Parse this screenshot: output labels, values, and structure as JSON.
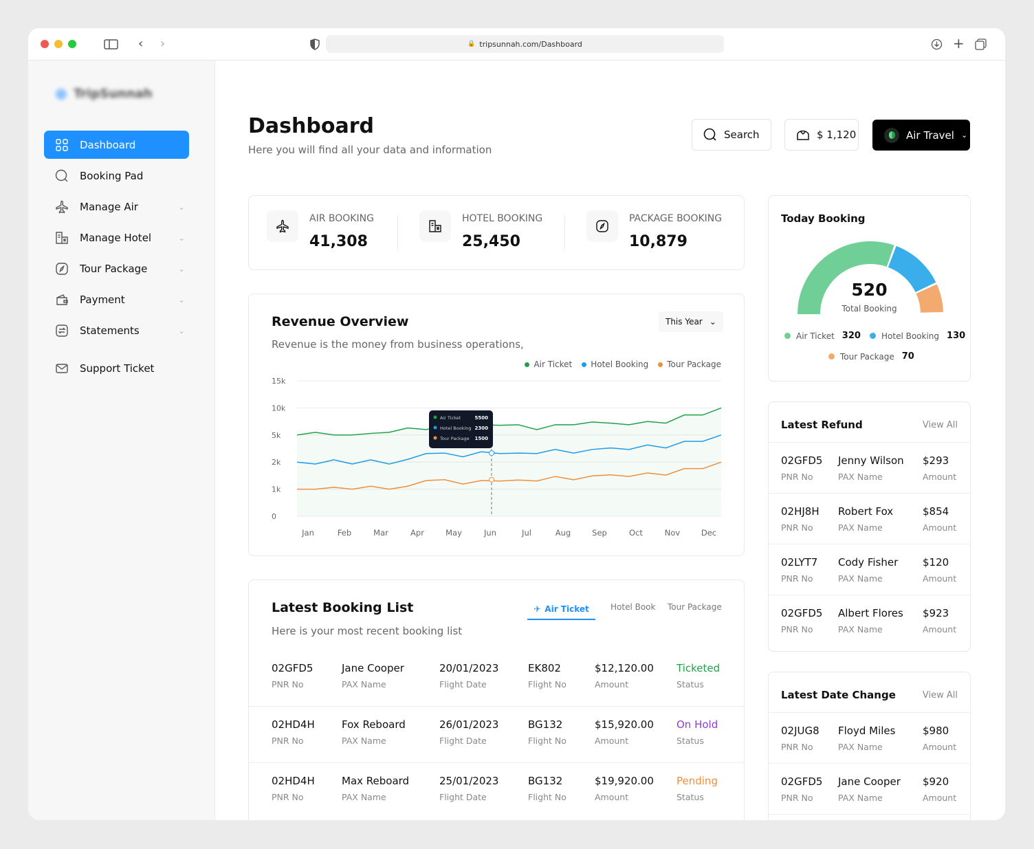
{
  "browser": {
    "url": "tripsunnah.com/Dashboard",
    "icons": [
      "sidebar-toggle-icon",
      "back-icon",
      "forward-icon",
      "shield-icon",
      "lock-icon",
      "download-icon",
      "new-tab-icon",
      "tabs-icon"
    ]
  },
  "sidebar": {
    "logo_text": "TripSunnah",
    "items": [
      {
        "label": "Dashboard",
        "icon": "grid-icon",
        "active": true
      },
      {
        "label": "Booking Pad",
        "icon": "search-icon"
      },
      {
        "label": "Manage Air",
        "icon": "plane-icon",
        "expandable": true
      },
      {
        "label": "Manage Hotel",
        "icon": "hotel-icon",
        "expandable": true
      },
      {
        "label": "Tour Package",
        "icon": "compass-icon",
        "expandable": true
      },
      {
        "label": "Payment",
        "icon": "wallet-icon",
        "expandable": true
      },
      {
        "label": "Statements",
        "icon": "statement-icon",
        "expandable": true
      },
      {
        "label": "Support Ticket",
        "icon": "mail-icon"
      }
    ]
  },
  "header": {
    "title": "Dashboard",
    "subtitle": "Here you will find all your data and information",
    "search_label": "Search",
    "balance": "$ 1,120",
    "travel_mode": "Air Travel"
  },
  "stats": [
    {
      "label": "AIR BOOKING",
      "value": "41,308",
      "icon": "plane-icon"
    },
    {
      "label": "HOTEL BOOKING",
      "value": "25,450",
      "icon": "hotel-icon"
    },
    {
      "label": "PACKAGE BOOKING",
      "value": "10,879",
      "icon": "compass-icon"
    }
  ],
  "revenue": {
    "title": "Revenue Overview",
    "subtitle": "Revenue is the money from business operations,",
    "period": "This Year"
  },
  "chart_data": {
    "type": "line",
    "categories": [
      "Jan",
      "Feb",
      "Mar",
      "Apr",
      "May",
      "Jun",
      "Jul",
      "Aug",
      "Sep",
      "Oct",
      "Nov",
      "Dec"
    ],
    "yticks": [
      "0",
      "1k",
      "2k",
      "5k",
      "10k",
      "15k"
    ],
    "ytick_values": [
      0,
      1000,
      2000,
      5000,
      10000,
      15000
    ],
    "grid": true,
    "legend": "top-right",
    "series": [
      {
        "name": "Air Ticket",
        "color": "#1fa14a",
        "values": [
          5000,
          5500,
          5000,
          5000,
          5300,
          5500,
          6300,
          6000,
          6800,
          7000,
          6900,
          6800,
          6900,
          6000,
          6900,
          6900,
          7400,
          7200,
          6900,
          7500,
          7200,
          8700,
          8700,
          10000
        ]
      },
      {
        "name": "Hotel Booking",
        "color": "#1e9be9",
        "values": [
          2000,
          1930,
          2250,
          1930,
          2250,
          1930,
          2300,
          2950,
          3000,
          2590,
          3150,
          2950,
          3000,
          2950,
          3400,
          3000,
          3400,
          3570,
          3400,
          3900,
          3570,
          4300,
          4300,
          5000
        ]
      },
      {
        "name": "Tour Package",
        "color": "#ef8f3b",
        "values": [
          1000,
          1000,
          1070,
          1000,
          1110,
          1000,
          1110,
          1320,
          1350,
          1190,
          1320,
          1300,
          1340,
          1300,
          1470,
          1350,
          1490,
          1530,
          1470,
          1600,
          1520,
          1760,
          1760,
          2000
        ]
      }
    ],
    "tooltip": {
      "category": "Jun",
      "rows": [
        {
          "name": "Air Ticket",
          "value": "5500"
        },
        {
          "name": "Hotel Booking",
          "value": "2300"
        },
        {
          "name": "Tour Package",
          "value": "1500"
        }
      ]
    }
  },
  "today": {
    "title": "Today Booking",
    "total": "520",
    "total_label": "Total Booking",
    "items": [
      {
        "name": "Air Ticket",
        "value": "320",
        "color": "#6fcf97"
      },
      {
        "name": "Hotel Booking",
        "value": "130",
        "color": "#3aaeeb"
      },
      {
        "name": "Tour Package",
        "value": "70",
        "color": "#f2aa6e"
      }
    ]
  },
  "booking_list": {
    "title": "Latest Booking List",
    "subtitle": "Here is your most recent booking list",
    "tabs": [
      "Air Ticket",
      "Hotel Book",
      "Tour Package"
    ],
    "sublabels": [
      "PNR No",
      "PAX Name",
      "Flight Date",
      "Flight No",
      "Amount",
      "Status"
    ],
    "rows": [
      {
        "pnr": "02GFD5",
        "name": "Jane Cooper",
        "date": "20/01/2023",
        "flight": "EK802",
        "amount": "$12,120.00",
        "status": "Ticketed",
        "status_color": "#1fa14a"
      },
      {
        "pnr": "02HD4H",
        "name": "Fox Reboard",
        "date": "26/01/2023",
        "flight": "BG132",
        "amount": "$15,920.00",
        "status": "On Hold",
        "status_color": "#8a3fd1"
      },
      {
        "pnr": "02HD4H",
        "name": "Max Reboard",
        "date": "25/01/2023",
        "flight": "BG132",
        "amount": "$19,920.00",
        "status": "Pending",
        "status_color": "#ef8f3b"
      }
    ]
  },
  "refund": {
    "title": "Latest Refund",
    "view_all": "View All",
    "sublabels": [
      "PNR No",
      "PAX Name",
      "Amount"
    ],
    "rows": [
      {
        "pnr": "02GFD5",
        "name": "Jenny Wilson",
        "amount": "$293"
      },
      {
        "pnr": "02HJ8H",
        "name": "Robert Fox",
        "amount": "$854"
      },
      {
        "pnr": "02LYT7",
        "name": "Cody Fisher",
        "amount": "$120"
      },
      {
        "pnr": "02GFD5",
        "name": "Albert Flores",
        "amount": "$923"
      }
    ]
  },
  "date_change": {
    "title": "Latest Date Change",
    "view_all": "View All",
    "sublabels": [
      "PNR No",
      "PAX Name",
      "Amount"
    ],
    "rows": [
      {
        "pnr": "02JUG8",
        "name": "Floyd Miles",
        "amount": "$980"
      },
      {
        "pnr": "02GFD5",
        "name": "Jane Cooper",
        "amount": "$920"
      }
    ]
  }
}
